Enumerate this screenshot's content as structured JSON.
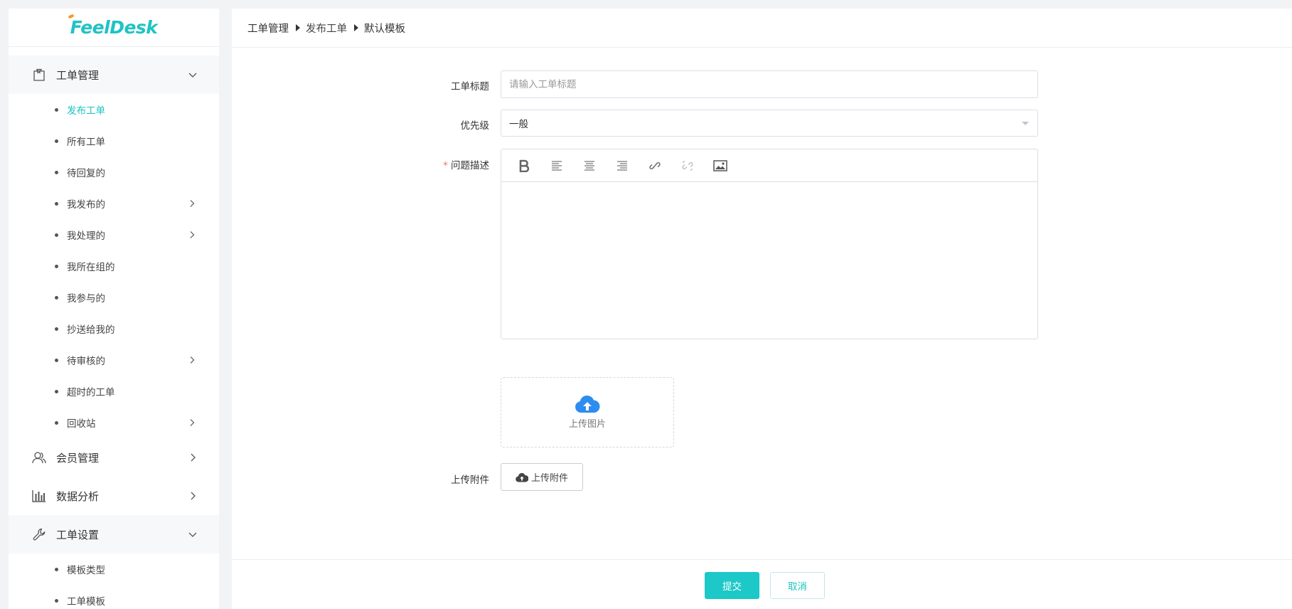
{
  "brand": {
    "logo_text": "FeelDesk"
  },
  "sidebar": {
    "groups": [
      {
        "label": "工单管理",
        "icon": "ticket-bag-icon",
        "items": [
          {
            "label": "发布工单",
            "active": true
          },
          {
            "label": "所有工单"
          },
          {
            "label": "待回复的"
          },
          {
            "label": "我发布的",
            "has_children": true
          },
          {
            "label": "我处理的",
            "has_children": true
          },
          {
            "label": "我所在组的"
          },
          {
            "label": "我参与的"
          },
          {
            "label": "抄送给我的"
          },
          {
            "label": "待审核的",
            "has_children": true
          },
          {
            "label": "超时的工单"
          },
          {
            "label": "回收站",
            "has_children": true
          }
        ]
      },
      {
        "label": "会员管理",
        "icon": "members-icon"
      },
      {
        "label": "数据分析",
        "icon": "bar-chart-icon"
      },
      {
        "label": "工单设置",
        "icon": "wrench-icon",
        "items": [
          {
            "label": "模板类型"
          },
          {
            "label": "工单模板"
          }
        ]
      }
    ]
  },
  "breadcrumb": [
    "工单管理",
    "发布工单",
    "默认模板"
  ],
  "form": {
    "title_label": "工单标题",
    "title_placeholder": "请输入工单标题",
    "priority_label": "优先级",
    "priority_value": "一般",
    "description_required_mark": "*",
    "description_label": "问题描述",
    "toolbar": [
      "bold-icon",
      "align-left-icon",
      "align-center-icon",
      "align-right-icon",
      "link-icon",
      "unlink-icon",
      "image-icon"
    ],
    "upload_image_label": "上传图片",
    "attachment_label": "上传附件",
    "attachment_button": "上传附件"
  },
  "footer": {
    "submit": "提交",
    "cancel": "取消"
  },
  "colors": {
    "accent": "#1cc8c8",
    "upload_blue": "#2d8cf0",
    "required": "#f56c6c"
  }
}
